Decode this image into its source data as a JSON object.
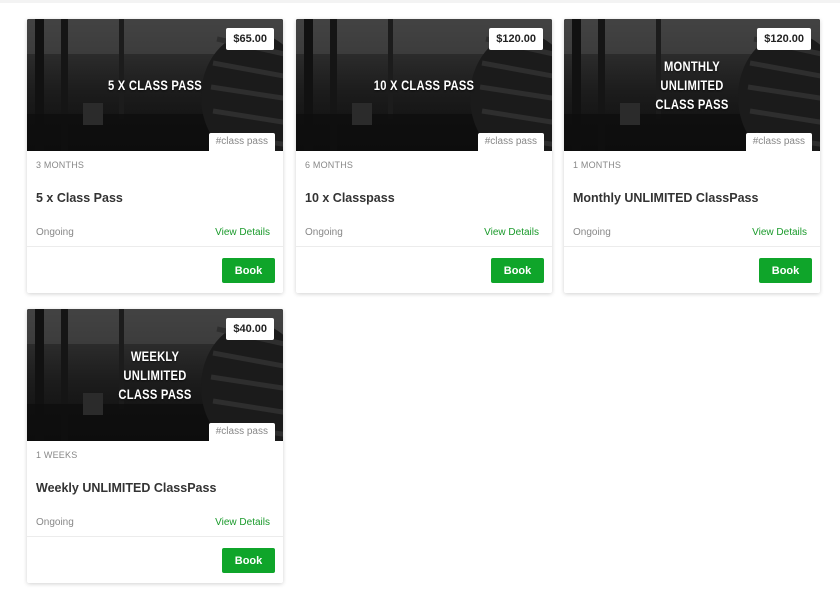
{
  "cards": [
    {
      "price": "$65.00",
      "overlay_title": "5 X CLASS PASS",
      "tag": "#class pass",
      "duration": "3 MONTHS",
      "name": "5 x Class Pass",
      "status": "Ongoing",
      "details_label": "View Details",
      "book_label": "Book"
    },
    {
      "price": "$120.00",
      "overlay_title": "10 X CLASS PASS",
      "tag": "#class pass",
      "duration": "6 MONTHS",
      "name": "10 x Classpass",
      "status": "Ongoing",
      "details_label": "View Details",
      "book_label": "Book"
    },
    {
      "price": "$120.00",
      "overlay_title": "MONTHLY\nUNLIMITED\nCLASS PASS",
      "tag": "#class pass",
      "duration": "1 MONTHS",
      "name": "Monthly UNLIMITED ClassPass",
      "status": "Ongoing",
      "details_label": "View Details",
      "book_label": "Book"
    },
    {
      "price": "$40.00",
      "overlay_title": "WEEKLY\nUNLIMITED\nCLASS PASS",
      "tag": "#class pass",
      "duration": "1 WEEKS",
      "name": "Weekly UNLIMITED ClassPass",
      "status": "Ongoing",
      "details_label": "View Details",
      "book_label": "Book"
    }
  ],
  "colors": {
    "book_button": "#0fa52a",
    "details_link": "#1a9a2b",
    "muted_text": "#888888"
  }
}
